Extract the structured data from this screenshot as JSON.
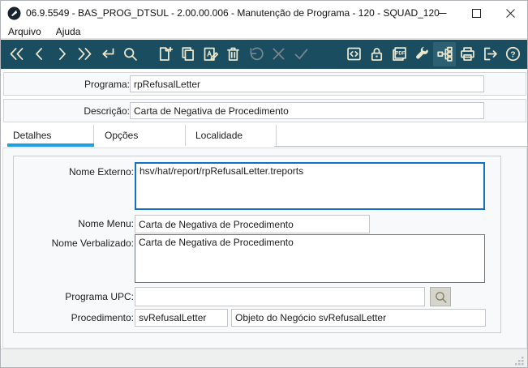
{
  "window": {
    "title": "06.9.5549 - BAS_PROG_DTSUL - 2.00.00.006 - Manutenção de Programa - 120 - SQUAD_120"
  },
  "menu": {
    "arquivo": "Arquivo",
    "ajuda": "Ajuda"
  },
  "toolbar": {
    "icon_names": [
      "first-record",
      "previous-record",
      "next-record",
      "last-record",
      "go",
      "search",
      "new-record",
      "copy-record",
      "edit-record",
      "delete-record",
      "undo",
      "cancel",
      "confirm",
      "code-window",
      "lock",
      "pdf-export",
      "tools-wrench",
      "program-tree",
      "print",
      "exit",
      "help"
    ],
    "disabled_icons": [
      "undo",
      "cancel",
      "confirm"
    ],
    "pdf_label": "PDF",
    "help_label": "?",
    "colors": {
      "background": "#1b4d60",
      "icon": "#ece7cf",
      "icon_disabled": "#76868d",
      "active_icon_bg": "#2d6073"
    }
  },
  "fields": {
    "programa": {
      "label": "Programa:",
      "value": "rpRefusalLetter"
    },
    "descricao": {
      "label": "Descrição:",
      "value": "Carta de Negativa de Procedimento"
    }
  },
  "tabs": [
    {
      "label": "Detalhes",
      "active": true
    },
    {
      "label": "Opções",
      "active": false
    },
    {
      "label": "Localidade",
      "active": false
    }
  ],
  "form": {
    "nome_externo": {
      "label": "Nome Externo:",
      "value": "hsv/hat/report/rpRefusalLetter.treports"
    },
    "nome_menu": {
      "label": "Nome Menu:",
      "value": "Carta de Negativa de Procedimento"
    },
    "nome_verbalizado": {
      "label": "Nome Verbalizado:",
      "value": "Carta de Negativa de Procedimento"
    },
    "programa_upc": {
      "label": "Programa UPC:",
      "value": ""
    },
    "procedimento": {
      "label": "Procedimento:",
      "value": "svRefusalLetter",
      "description": "Objeto do Negócio svRefusalLetter"
    }
  },
  "colors": {
    "active_tab_underline": "#1ba1e2",
    "focused_field_border": "#1271c4",
    "toolbar_background": "#1b4d60"
  }
}
